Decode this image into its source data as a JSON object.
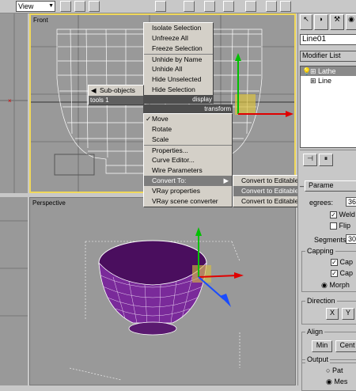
{
  "toolbar": {
    "view_combo": "View"
  },
  "viewports": {
    "front_label": "Front",
    "perspective_label": "Perspective"
  },
  "quad_menu": {
    "upper": [
      "Isolate Selection",
      "Unfreeze All",
      "Freeze Selection",
      "Unhide by Name",
      "Unhide All",
      "Hide Unselected",
      "Hide Selection"
    ],
    "subobjects": "Sub-objects",
    "tools_header_left": "tools 1",
    "display_label": "display",
    "transform_label": "transform",
    "lower": [
      "Move",
      "Rotate",
      "Scale",
      "Properties...",
      "Curve Editor...",
      "Wire Parameters",
      "Convert To:",
      "VRay properties",
      "VRay scene converter"
    ],
    "move_check": "✓",
    "convert_submenu": [
      "Convert to Editable Mesh",
      "Convert to Editable Poly",
      "Convert to Editable Patch"
    ]
  },
  "command_panel": {
    "object_name": "Line01",
    "modifier_list": "Modifier List",
    "stack": [
      "Lathe",
      "Line"
    ],
    "params_tab": "Parame",
    "degrees_label": "egrees:",
    "degrees_value": "36",
    "weld_label": "Weld",
    "flip_label": "Flip",
    "segments_label": "Segments:",
    "segments_value": "30",
    "capping_title": "Capping",
    "cap_start": "Cap",
    "cap_end": "Cap",
    "morph_label": "Morph",
    "direction_title": "Direction",
    "dir_x": "X",
    "dir_y": "Y",
    "align_title": "Align",
    "align_min": "Min",
    "align_center": "Cent",
    "output_title": "Output",
    "output_patch": "Pat",
    "output_mesh": "Mes"
  },
  "colors": {
    "accent": "#f0d85a",
    "highlight": "#7d7d7d",
    "purple": "#7a2a9a"
  }
}
